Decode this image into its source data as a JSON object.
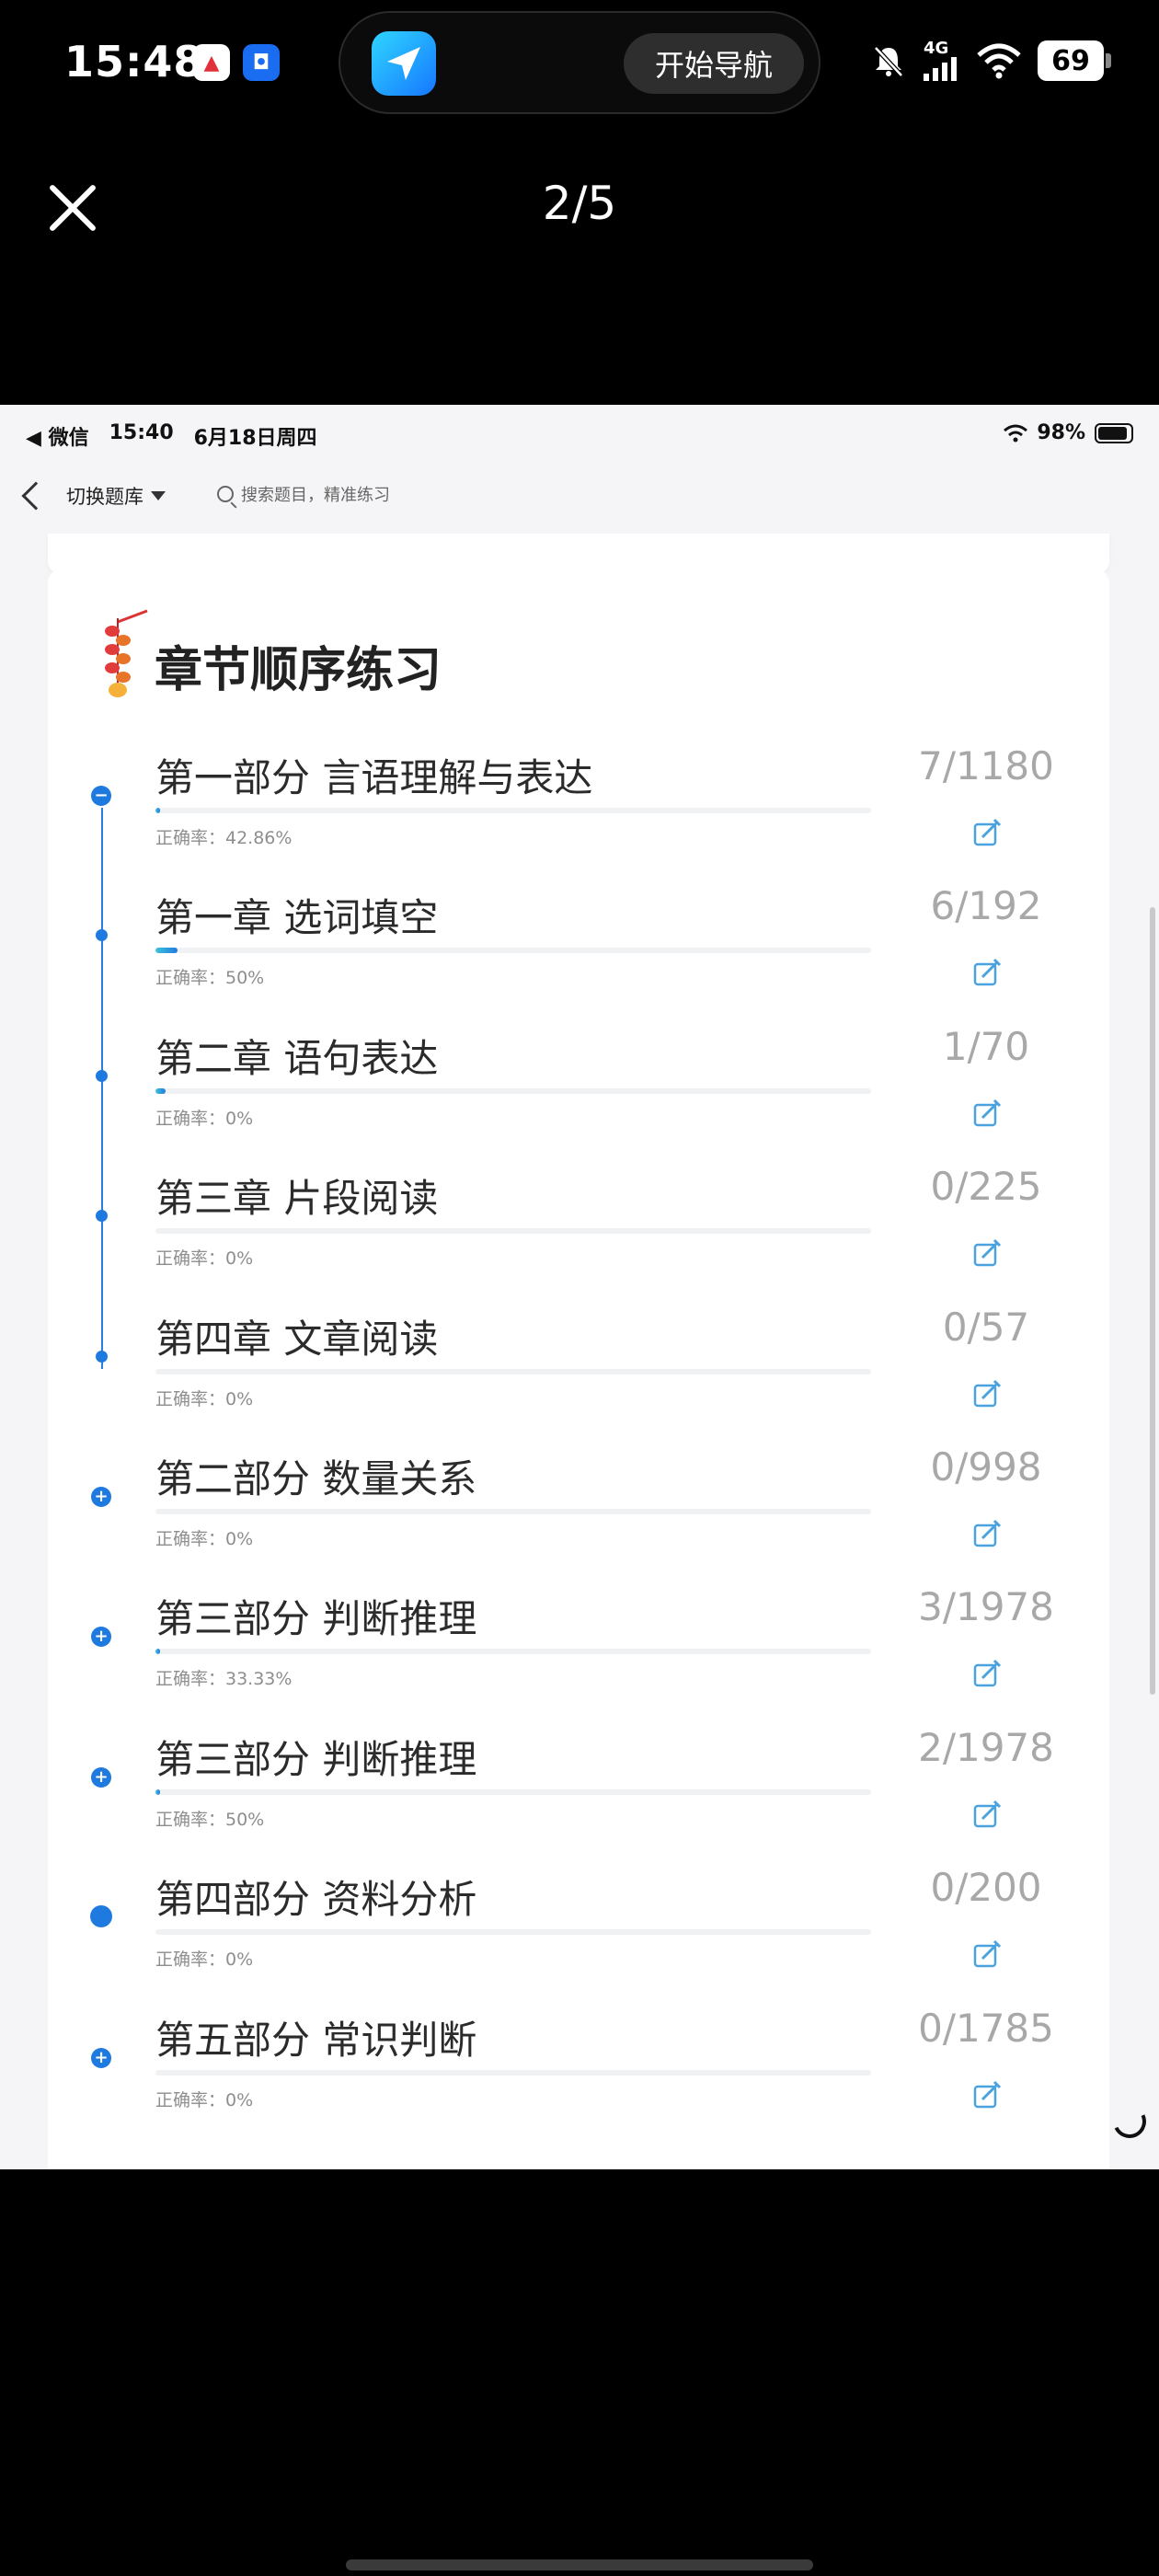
{
  "phone_status": {
    "time": "15:48",
    "notification_icons": [
      "app-red-icon",
      "app-blue-shield-icon"
    ],
    "island_app_icon": "map-navigation-icon",
    "island_button": "开始导航",
    "network": "4G",
    "battery": "69",
    "status_icons": [
      "bell-muted-icon",
      "signal-icon",
      "wifi-icon",
      "battery-icon"
    ]
  },
  "viewer": {
    "close_icon": "close-icon",
    "page_indicator": "2/5"
  },
  "screenshot": {
    "status": {
      "back_app": "◀ 微信",
      "time": "15:40",
      "date": "6月18日周四",
      "battery": "98%"
    },
    "nav": {
      "switch_label": "切换题库",
      "search_placeholder": "搜索题目，精准练习"
    },
    "section": {
      "title": "章节顺序练习",
      "icon": "firecracker-icon",
      "items": [
        {
          "name": "第一部分 言语理解与表达",
          "accuracy": "正确率：42.86%",
          "count": "7/1180",
          "progress": 0.006,
          "marker": "minus"
        },
        {
          "name": "第一章 选词填空",
          "accuracy": "正确率：50%",
          "count": "6/192",
          "progress": 0.031,
          "marker": "small"
        },
        {
          "name": "第二章 语句表达",
          "accuracy": "正确率：0%",
          "count": "1/70",
          "progress": 0.014,
          "marker": "small"
        },
        {
          "name": "第三章 片段阅读",
          "accuracy": "正确率：0%",
          "count": "0/225",
          "progress": 0,
          "marker": "small"
        },
        {
          "name": "第四章 文章阅读",
          "accuracy": "正确率：0%",
          "count": "0/57",
          "progress": 0,
          "marker": "small"
        },
        {
          "name": "第二部分 数量关系",
          "accuracy": "正确率：0%",
          "count": "0/998",
          "progress": 0,
          "marker": "plus"
        },
        {
          "name": "第三部分 判断推理",
          "accuracy": "正确率：33.33%",
          "count": "3/1978",
          "progress": 0.0015,
          "marker": "plus"
        },
        {
          "name": "第三部分 判断推理",
          "accuracy": "正确率：50%",
          "count": "2/1978",
          "progress": 0.001,
          "marker": "plus"
        },
        {
          "name": "第四部分 资料分析",
          "accuracy": "正确率：0%",
          "count": "0/200",
          "progress": 0,
          "marker": "plain"
        },
        {
          "name": "第五部分 常识判断",
          "accuracy": "正确率：0%",
          "count": "0/1785",
          "progress": 0,
          "marker": "plus"
        }
      ]
    }
  },
  "colors": {
    "accent": "#1f7ae0",
    "edit_icon": "#4aa3df",
    "count_text": "#a8a8a8"
  }
}
